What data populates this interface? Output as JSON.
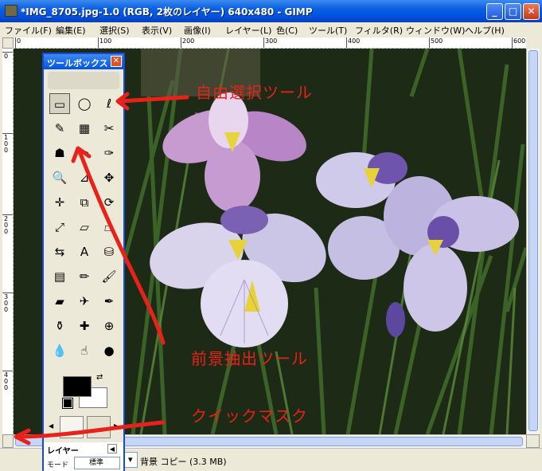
{
  "window": {
    "title": "*IMG_8705.jpg-1.0 (RGB, 2枚のレイヤー) 640x480 - GIMP",
    "minimize": "_",
    "maximize": "□",
    "close": "✕"
  },
  "menu": {
    "items": [
      "ファイル(F)",
      "編集(E)",
      "選択(S)",
      "表示(V)",
      "画像(I)",
      "レイヤー(L)",
      "色(C)",
      "ツール(T)",
      "フィルタ(R)",
      "ウィンドウ(W)",
      "ヘルプ(H)"
    ]
  },
  "rulers": {
    "horizontal": [
      "0",
      "100",
      "200",
      "300",
      "400",
      "500",
      "600"
    ],
    "vertical": [
      "0",
      "100",
      "200",
      "300",
      "400"
    ]
  },
  "toolbox": {
    "title": "ツールボックス",
    "close": "✕",
    "tools": [
      "rect-select-icon",
      "ellipse-select-icon",
      "free-select-icon",
      "fuzzy-select-icon",
      "color-select-icon",
      "scissors-icon",
      "foreground-select-icon",
      "paths-icon",
      "color-picker-icon",
      "zoom-icon",
      "measure-icon",
      "move-icon",
      "align-icon",
      "crop-icon",
      "rotate-icon",
      "scale-icon",
      "shear-icon",
      "perspective-icon",
      "flip-icon",
      "text-icon",
      "bucket-fill-icon",
      "blend-icon",
      "pencil-icon",
      "paintbrush-icon",
      "eraser-icon",
      "airbrush-icon",
      "ink-icon",
      "clone-icon",
      "heal-icon",
      "perspective-clone-icon",
      "blur-icon",
      "smudge-icon",
      "dodge-burn-icon"
    ],
    "tool_glyphs": [
      "▭",
      "◯",
      "ℓ",
      "✎",
      "▦",
      "✂",
      "☗",
      "✒",
      "✑",
      "🔍",
      "⊿",
      "✥",
      "✛",
      "⧉",
      "⟳",
      "⤢",
      "▱",
      "⏢",
      "⇆",
      "A",
      "⛁",
      "▤",
      "✏",
      "🖌",
      "▰",
      "✈",
      "✒",
      "⚱",
      "✚",
      "⊕",
      "💧",
      "☝",
      "●"
    ],
    "foreground_color": "#000000",
    "background_color": "#ffffff",
    "tab_left": "◀",
    "tab_right": "▶"
  },
  "layers_dock": {
    "title": "レイヤー",
    "close": "◀",
    "mode_label": "モード",
    "mode_value": "標準"
  },
  "status": {
    "text": "背景 コピー (3.3 MB)",
    "unit_arrow": "▾"
  },
  "annotations": {
    "free_select": "自由選択ツール",
    "foreground_select": "前景抽出ツール",
    "quick_mask": "クイックマスク",
    "color": "#e8211b"
  }
}
